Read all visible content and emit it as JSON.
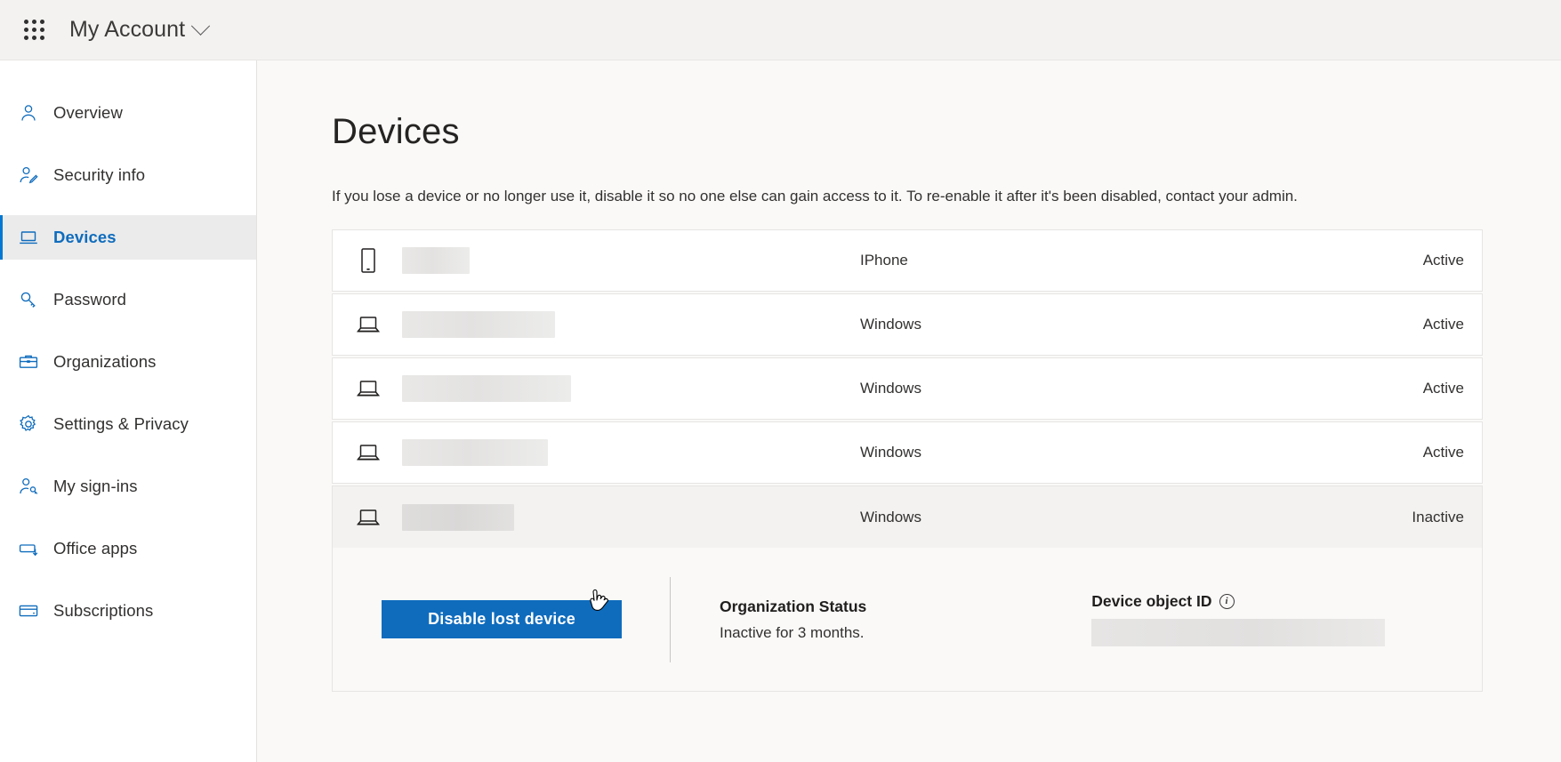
{
  "topbar": {
    "waffle_icon": "app-launcher-icon",
    "title": "My Account",
    "chevron_icon": "chevron-down-icon"
  },
  "sidebar": {
    "items": [
      {
        "label": "Overview",
        "icon": "person-icon",
        "active": false
      },
      {
        "label": "Security info",
        "icon": "person-edit-icon",
        "active": false
      },
      {
        "label": "Devices",
        "icon": "laptop-icon",
        "active": true
      },
      {
        "label": "Password",
        "icon": "key-icon",
        "active": false
      },
      {
        "label": "Organizations",
        "icon": "briefcase-icon",
        "active": false
      },
      {
        "label": "Settings & Privacy",
        "icon": "gear-icon",
        "active": false
      },
      {
        "label": "My sign-ins",
        "icon": "person-key-icon",
        "active": false
      },
      {
        "label": "Office apps",
        "icon": "office-apps-icon",
        "active": false
      },
      {
        "label": "Subscriptions",
        "icon": "credit-card-icon",
        "active": false
      }
    ]
  },
  "main": {
    "title": "Devices",
    "description": "If you lose a device or no longer use it, disable it so no one else can gain access to it. To re-enable it after it's been disabled, contact your admin.",
    "devices": [
      {
        "icon": "phone-icon",
        "name_redacted": true,
        "name_width": 76,
        "os": "IPhone",
        "status": "Active",
        "selected": false
      },
      {
        "icon": "laptop-icon",
        "name_redacted": true,
        "name_width": 172,
        "os": "Windows",
        "status": "Active",
        "selected": false
      },
      {
        "icon": "laptop-icon",
        "name_redacted": true,
        "name_width": 190,
        "os": "Windows",
        "status": "Active",
        "selected": false
      },
      {
        "icon": "laptop-icon",
        "name_redacted": true,
        "name_width": 164,
        "os": "Windows",
        "status": "Active",
        "selected": false
      },
      {
        "icon": "laptop-icon",
        "name_redacted": true,
        "name_width": 126,
        "os": "Windows",
        "status": "Inactive",
        "selected": true
      }
    ],
    "detail": {
      "disable_button_label": "Disable lost device",
      "org_status_label": "Organization Status",
      "org_status_value": "Inactive for 3 months.",
      "device_object_id_label": "Device object ID",
      "device_object_id_info_icon": "info-icon",
      "device_object_id_redacted": true
    }
  },
  "colors": {
    "accent": "#0f6cbd",
    "topbar_bg": "#f3f2f1",
    "main_bg": "#faf9f8",
    "selected_row_bg": "#f3f2f1",
    "text": "#323130"
  },
  "cursor": {
    "icon": "pointer-hand-cursor"
  }
}
